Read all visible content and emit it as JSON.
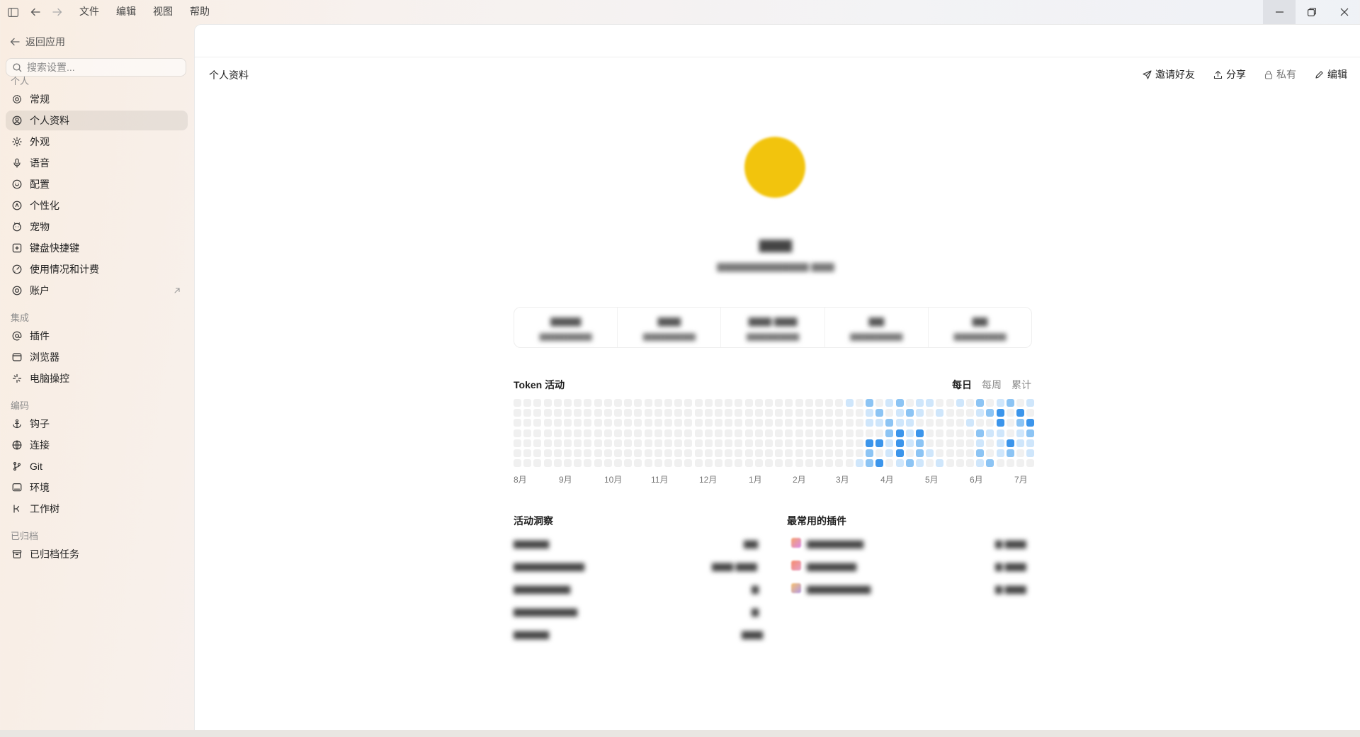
{
  "titlebar": {
    "menus": [
      "文件",
      "编辑",
      "视图",
      "帮助"
    ],
    "icons": [
      "sidebar-toggle-icon",
      "arrow-left-icon",
      "arrow-right-icon"
    ],
    "window_buttons": [
      "minimize-icon",
      "restore-icon",
      "close-icon"
    ]
  },
  "sidebar": {
    "back_label": "返回应用",
    "search_placeholder": "搜索设置...",
    "sections": [
      {
        "title": "个人",
        "items": [
          {
            "label": "常规",
            "icon": "gear-icon"
          },
          {
            "label": "个人资料",
            "icon": "user-circle-icon",
            "active": true
          },
          {
            "label": "外观",
            "icon": "sun-icon"
          },
          {
            "label": "语音",
            "icon": "microphone-icon"
          },
          {
            "label": "配置",
            "icon": "config-icon"
          },
          {
            "label": "个性化",
            "icon": "personalize-icon"
          },
          {
            "label": "宠物",
            "icon": "pet-icon"
          },
          {
            "label": "键盘快捷键",
            "icon": "keyboard-icon"
          },
          {
            "label": "使用情况和计费",
            "icon": "gauge-icon"
          },
          {
            "label": "账户",
            "icon": "account-icon",
            "external": true
          }
        ]
      },
      {
        "title": "集成",
        "items": [
          {
            "label": "插件",
            "icon": "at-icon"
          },
          {
            "label": "浏览器",
            "icon": "browser-icon"
          },
          {
            "label": "电脑操控",
            "icon": "sparkle-icon"
          }
        ]
      },
      {
        "title": "编码",
        "items": [
          {
            "label": "钩子",
            "icon": "anchor-icon"
          },
          {
            "label": "连接",
            "icon": "globe-icon"
          },
          {
            "label": "Git",
            "icon": "git-branch-icon"
          },
          {
            "label": "环境",
            "icon": "monitor-icon"
          },
          {
            "label": "工作树",
            "icon": "worktree-icon"
          }
        ]
      },
      {
        "title": "已归档",
        "items": [
          {
            "label": "已归档任务",
            "icon": "archive-icon"
          }
        ]
      }
    ]
  },
  "main": {
    "title": "个人资料",
    "actions": {
      "invite": "邀请好友",
      "share": "分享",
      "private": "私有",
      "edit": "编辑"
    },
    "profile": {
      "avatar_color": "#f2c40d"
    },
    "activity": {
      "title": "Token 活动",
      "tabs": [
        "每日",
        "每周",
        "累计"
      ],
      "active_tab": "每日",
      "months": [
        "8月",
        "9月",
        "10月",
        "11月",
        "12月",
        "1月",
        "2月",
        "3月",
        "4月",
        "5月",
        "6月",
        "7月"
      ],
      "colors": {
        "empty": "#f0f0f0",
        "low": "#cfe6fb",
        "mid": "#8cc4f4",
        "high": "#3b95eb"
      }
    },
    "insights": {
      "title": "活动洞察"
    },
    "plugins": {
      "title": "最常用的插件"
    }
  }
}
